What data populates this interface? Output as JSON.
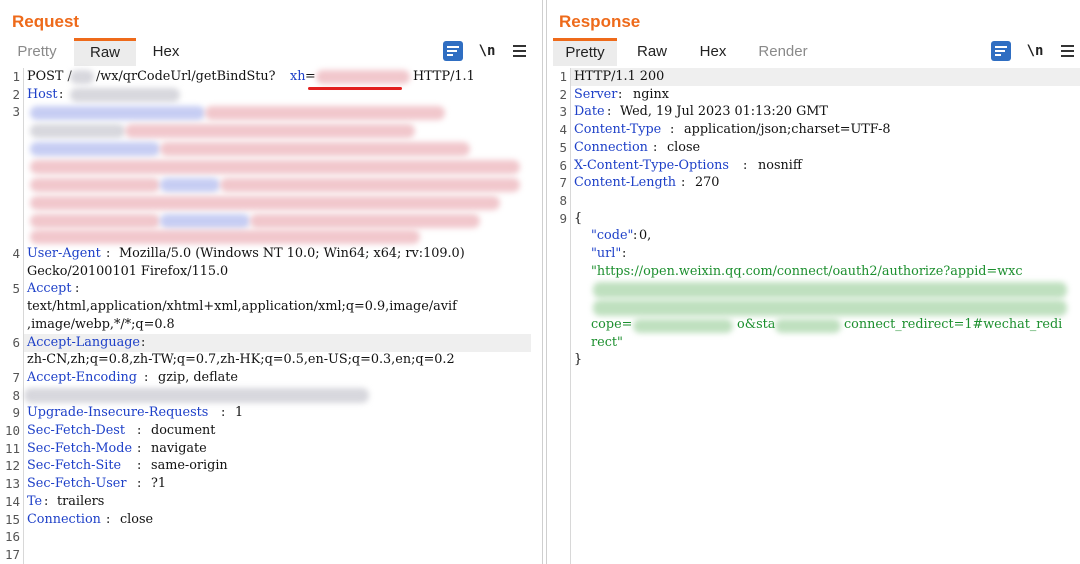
{
  "layout_toggle": {
    "icons": [
      "split-columns-icon",
      "split-rows-icon",
      "single-pane-icon"
    ],
    "active_index": 0
  },
  "request": {
    "title": "Request",
    "tabs": [
      "Pretty",
      "Raw",
      "Hex"
    ],
    "active_tab": "Raw",
    "line_numbers": [
      "1",
      "2",
      "3",
      "4",
      "5",
      "6",
      "7",
      "8",
      "9",
      "10",
      "11",
      "12",
      "13",
      "14",
      "15",
      "16",
      "17"
    ],
    "lines": {
      "l1_method": "POST /",
      "l1_path": "/wx/qrCodeUrl/getBindStu?",
      "l1_param": "xh",
      "l1_eq": "=",
      "l1_proto": "HTTP/1.1",
      "l2_key": "Host",
      "l4_key": "User-Agent",
      "l4_val": "Mozilla/5.0 (Windows NT 10.0; Win64; x64; rv:109.0)",
      "l4_cont": "Gecko/20100101 Firefox/115.0",
      "l5_key": "Accept",
      "l5_cont1": "text/html,application/xhtml+xml,application/xml;q=0.9,image/avif",
      "l5_cont2": ",image/webp,*/*;q=0.8",
      "l6_key": "Accept-Language",
      "l6_cont": "zh-CN,zh;q=0.8,zh-TW;q=0.7,zh-HK;q=0.5,en-US;q=0.3,en;q=0.2",
      "l7_key": "Accept-Encoding",
      "l7_val": "gzip, deflate",
      "l9_key": "Upgrade-Insecure-Requests",
      "l9_val": "1",
      "l10_key": "Sec-Fetch-Dest",
      "l10_val": "document",
      "l11_key": "Sec-Fetch-Mode",
      "l11_val": "navigate",
      "l12_key": "Sec-Fetch-Site",
      "l12_val": "same-origin",
      "l13_key": "Sec-Fetch-User",
      "l13_val": "?1",
      "l14_key": "Te",
      "l14_val": "trailers",
      "l15_key": "Connection",
      "l15_val": "close"
    }
  },
  "response": {
    "title": "Response",
    "tabs": [
      "Pretty",
      "Raw",
      "Hex",
      "Render"
    ],
    "active_tab": "Pretty",
    "line_numbers": [
      "1",
      "2",
      "3",
      "4",
      "5",
      "6",
      "7",
      "8",
      "9"
    ],
    "lines": {
      "l1": "HTTP/1.1 200",
      "l2_key": "Server",
      "l2_val": "nginx",
      "l3_key": "Date",
      "l3_val": "Wed, 19 Jul 2023 01:13:20 GMT",
      "l4_key": "Content-Type",
      "l4_val": "application/json;charset=UTF-8",
      "l5_key": "Connection",
      "l5_val": "close",
      "l6_key": "X-Content-Type-Options",
      "l6_val": "nosniff",
      "l7_key": "Content-Length",
      "l7_val": "270",
      "l9_open": "{",
      "j_code_key": "\"code\"",
      "j_code_val": "0,",
      "j_url_key": "\"url\"",
      "j_url_l1": "\"https://open.weixin.qq.com/connect/oauth2/authorize?appid=wxc",
      "j_url_l3a": "cope=",
      "j_url_l3b": "o&sta",
      "j_url_l3c": "connect_redirect=1#wechat_redi",
      "j_url_l4": "rect\"",
      "close": "}"
    }
  },
  "colors": {
    "accent": "#ee6a1a",
    "key_blue": "#1e40c8",
    "string_green": "#1c8f2e",
    "active_tool": "#2f6ec2",
    "annotation_red": "#e21f1f"
  }
}
